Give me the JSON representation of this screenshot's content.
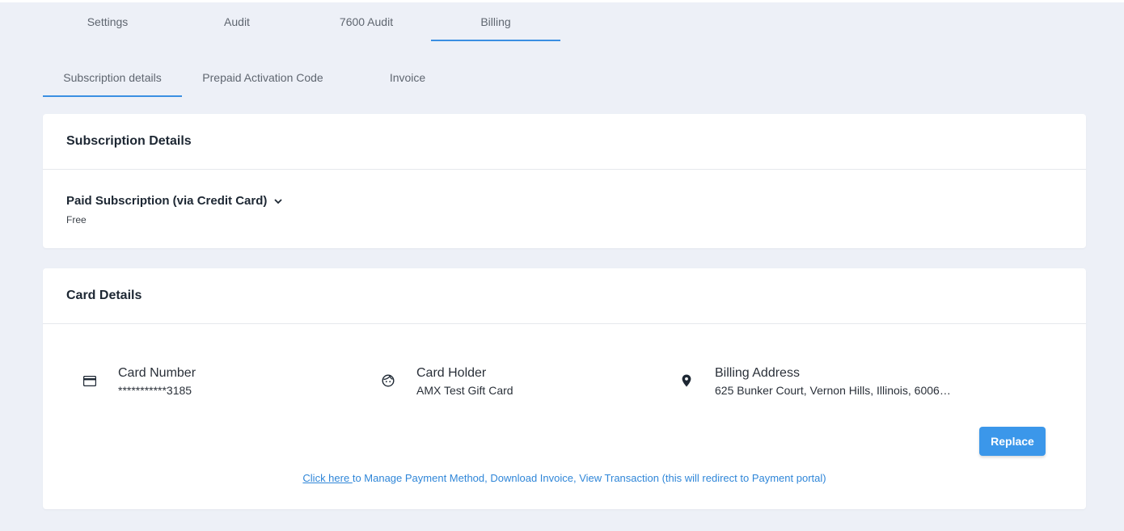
{
  "top_tabs": [
    {
      "label": "Settings"
    },
    {
      "label": "Audit"
    },
    {
      "label": "7600 Audit"
    },
    {
      "label": "Billing",
      "active": true
    }
  ],
  "sub_tabs": [
    {
      "label": "Subscription details",
      "active": true
    },
    {
      "label": "Prepaid Activation Code"
    },
    {
      "label": "Invoice"
    }
  ],
  "subscription": {
    "title": "Subscription Details",
    "plan": "Paid Subscription (via Credit Card)",
    "plan_value": "Free",
    "icon": "chevron-down-icon"
  },
  "card_details": {
    "title": "Card Details",
    "card_number": {
      "label": "Card Number",
      "value": "***********3185",
      "icon": "credit-card-icon"
    },
    "card_holder": {
      "label": "Card Holder",
      "value": "AMX Test Gift Card",
      "icon": "face-icon"
    },
    "billing_address": {
      "label": "Billing Address",
      "value": "625 Bunker Court, Vernon Hills, Illinois, 6006…",
      "icon": "location-pin-icon"
    },
    "replace_label": "Replace",
    "link_text": "Click here ",
    "link_rest": "to Manage Payment Method, Download Invoice, View Transaction (this will redirect to Payment portal)"
  },
  "colors": {
    "accent": "#3b8fe2",
    "button": "#3b97ea",
    "background": "#edf0f7"
  }
}
